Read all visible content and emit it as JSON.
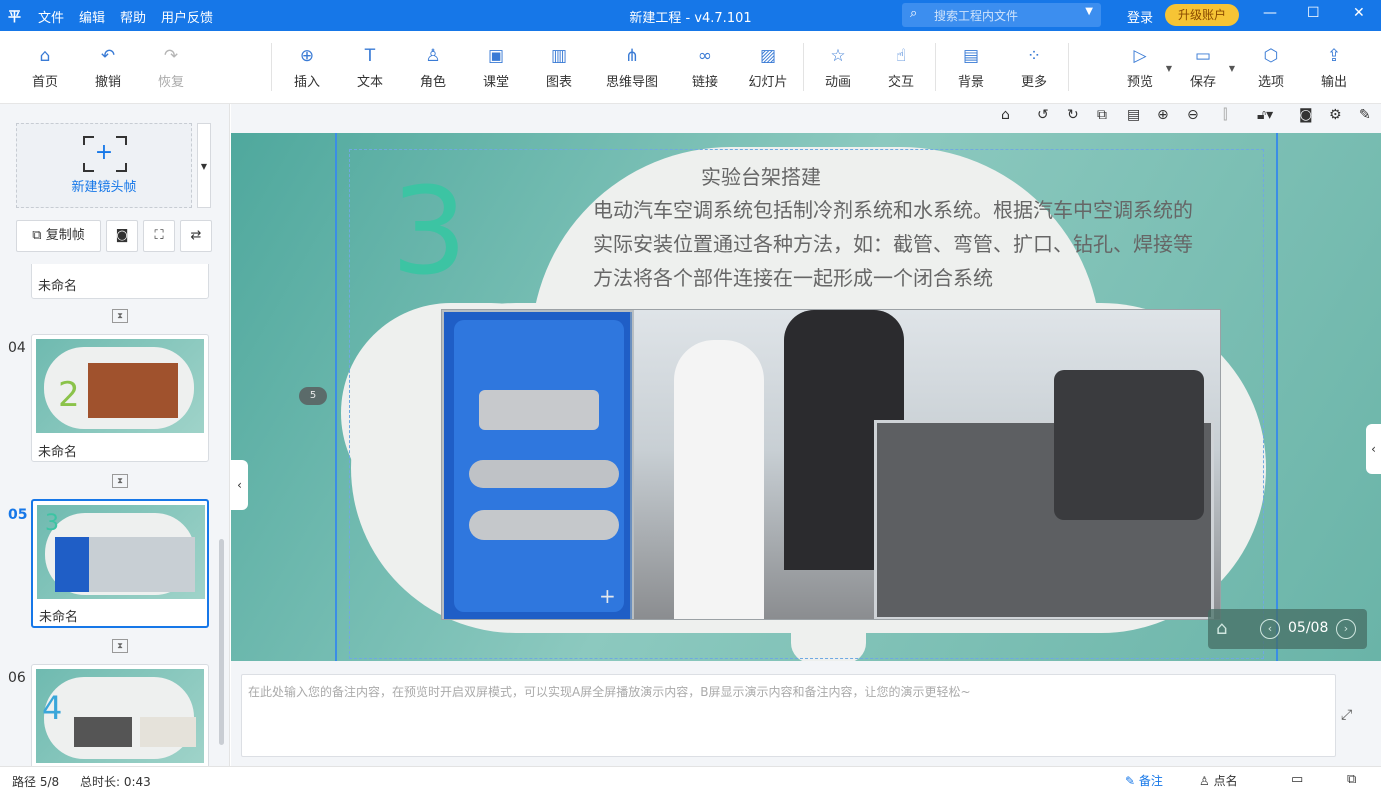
{
  "app": {
    "logo": "平",
    "title": "新建工程 - v4.7.101",
    "menu": [
      "文件",
      "编辑",
      "帮助",
      "用户反馈"
    ],
    "search_placeholder": "搜索工程内文件",
    "login": "登录",
    "upgrade": "升级账户",
    "window_controls": [
      "minimize-icon",
      "maximize-icon",
      "close-icon"
    ]
  },
  "toolbar": {
    "home": "首页",
    "undo": "撤销",
    "redo": "恢复",
    "insert": "插入",
    "text": "文本",
    "role": "角色",
    "classroom": "课堂",
    "chart": "图表",
    "mindmap": "思维导图",
    "link": "链接",
    "slideshow": "幻灯片",
    "animation": "动画",
    "interaction": "交互",
    "background": "背景",
    "more": "更多",
    "preview": "预览",
    "save": "保存",
    "options": "选项",
    "export": "输出"
  },
  "left_panel": {
    "new_frame": "新建镜头帧",
    "copy_frame": "复制帧",
    "thumbnails": [
      {
        "num": "",
        "name": "未命名"
      },
      {
        "num": "04",
        "name": "未命名",
        "big_number": "2"
      },
      {
        "num": "05",
        "name": "未命名",
        "big_number": "3",
        "active": true
      },
      {
        "num": "06",
        "name": "",
        "big_number": "4"
      }
    ]
  },
  "slide": {
    "big_number": "3",
    "title": "实验台架搭建",
    "body": "电动汽车空调系统包括制冷剂系统和水系统。根据汽车中空调系统的实际安装位置通过各种方法，如：截管、弯管、扩口、钻孔、焊接等方法将各个部件连接在一起形成一个闭合系统",
    "badge": "5"
  },
  "navigation": {
    "page": "05/08"
  },
  "notes": {
    "placeholder": "在此处输入您的备注内容，在预览时开启双屏模式，可以实现A屏全屏播放演示内容，B屏显示演示内容和备注内容，让您的演示更轻松~"
  },
  "status": {
    "path": "路径 5/8",
    "duration": "总时长: 0:43",
    "notes": "备注",
    "roll_call": "点名"
  },
  "colors": {
    "accent": "#1677e8",
    "upgrade": "#f6c435",
    "slide_number": "#3cc4a3"
  }
}
